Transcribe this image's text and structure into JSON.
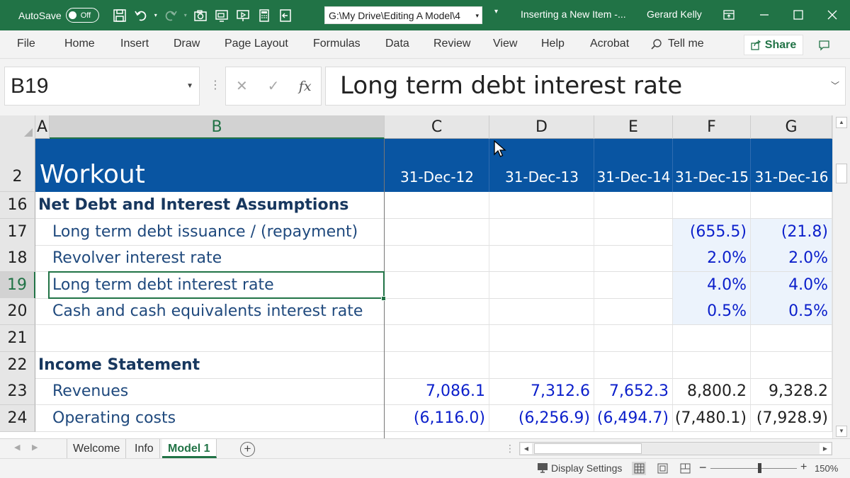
{
  "titlebar": {
    "autosave_label": "AutoSave",
    "autosave_state": "Off",
    "path": "G:\\My Drive\\Editing A Model\\4",
    "doc_title": "Inserting a New Item -...",
    "user": "Gerard Kelly",
    "icons": [
      "save-icon",
      "undo-icon",
      "redo-icon",
      "camera-icon",
      "screenshot-icon",
      "presentation-icon",
      "calculator-icon",
      "exit-icon"
    ]
  },
  "ribbon": {
    "tabs": [
      "File",
      "Home",
      "Insert",
      "Draw",
      "Page Layout",
      "Formulas",
      "Data",
      "Review",
      "View",
      "Help",
      "Acrobat"
    ],
    "tell_me": "Tell me",
    "share": "Share"
  },
  "formula_bar": {
    "name_box": "B19",
    "fx": "fx",
    "formula": "Long term debt interest rate"
  },
  "columns": [
    "A",
    "B",
    "C",
    "D",
    "E",
    "F",
    "G"
  ],
  "selected_column": "B",
  "header": {
    "row_num": "2",
    "title": "Workout",
    "dates": [
      "31-Dec-12",
      "31-Dec-13",
      "31-Dec-14",
      "31-Dec-15",
      "31-Dec-16"
    ]
  },
  "rows": [
    {
      "num": "16",
      "label": "Net Debt and Interest Assumptions",
      "kind": "section",
      "values": [
        "",
        "",
        "",
        "",
        ""
      ]
    },
    {
      "num": "17",
      "label": "Long term debt issuance / (repayment)",
      "kind": "item",
      "values": [
        "",
        "",
        "",
        "(655.5)",
        "(21.8)"
      ]
    },
    {
      "num": "18",
      "label": "Revolver interest rate",
      "kind": "item",
      "values": [
        "",
        "",
        "",
        "2.0%",
        "2.0%"
      ]
    },
    {
      "num": "19",
      "label": "Long term debt interest rate",
      "kind": "item",
      "values": [
        "",
        "",
        "",
        "4.0%",
        "4.0%"
      ]
    },
    {
      "num": "20",
      "label": "Cash and cash equivalents interest rate",
      "kind": "item",
      "values": [
        "",
        "",
        "",
        "0.5%",
        "0.5%"
      ]
    },
    {
      "num": "21",
      "label": "",
      "kind": "blank",
      "values": [
        "",
        "",
        "",
        "",
        ""
      ]
    },
    {
      "num": "22",
      "label": "Income Statement",
      "kind": "section",
      "values": [
        "",
        "",
        "",
        "",
        ""
      ]
    },
    {
      "num": "23",
      "label": "Revenues",
      "kind": "item",
      "values": [
        "7,086.1",
        "7,312.6",
        "7,652.3",
        "8,800.2",
        "9,328.2"
      ]
    },
    {
      "num": "24",
      "label": "Operating costs",
      "kind": "item",
      "values": [
        "(6,116.0)",
        "(6,256.9)",
        "(6,494.7)",
        "(7,480.1)",
        "(7,928.9)"
      ]
    }
  ],
  "active_row": "19",
  "sheets": {
    "tabs": [
      "Welcome",
      "Info",
      "Model 1"
    ],
    "active": "Model 1"
  },
  "status": {
    "display_settings": "Display Settings",
    "zoom": "150%"
  },
  "colors": {
    "accent": "#217346",
    "header_band": "#0955a2",
    "input_blue": "#0b1fcb",
    "label_blue": "#1f497d",
    "input_fill": "#ecf3fc"
  }
}
